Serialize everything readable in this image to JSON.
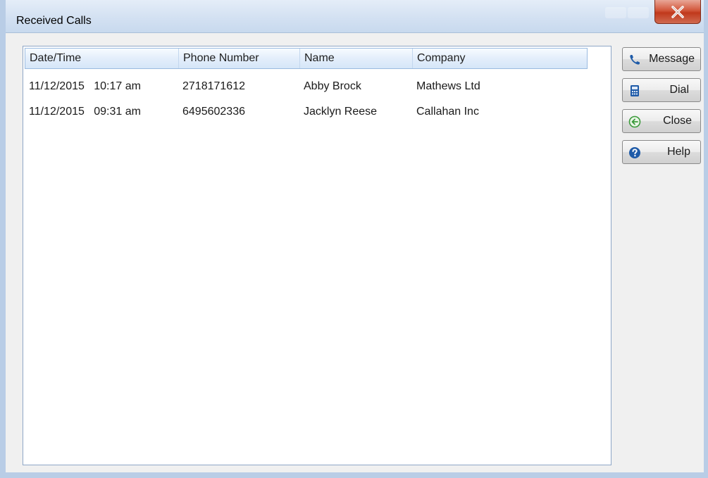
{
  "window": {
    "title": "Received Calls"
  },
  "list": {
    "columns": [
      "Date/Time",
      "Phone Number",
      "Name",
      "Company"
    ],
    "rows": [
      {
        "datetime": "11/12/2015   10:17 am",
        "phone": "2718171612",
        "name": "Abby Brock",
        "company": "Mathews Ltd"
      },
      {
        "datetime": "11/12/2015   09:31 am",
        "phone": "6495602336",
        "name": "Jacklyn Reese",
        "company": "Callahan Inc"
      }
    ]
  },
  "buttons": {
    "message": {
      "label": "Message",
      "icon": "phone-icon"
    },
    "dial": {
      "label": "Dial",
      "icon": "calculator-icon"
    },
    "close": {
      "label": "Close",
      "icon": "back-arrow-icon"
    },
    "help": {
      "label": "Help",
      "icon": "help-icon"
    }
  },
  "colors": {
    "header_gradient": "#d6e6f8",
    "close_button": "#c0391c",
    "help_icon": "#1f5ba8",
    "back_icon": "#3c9a3c"
  }
}
